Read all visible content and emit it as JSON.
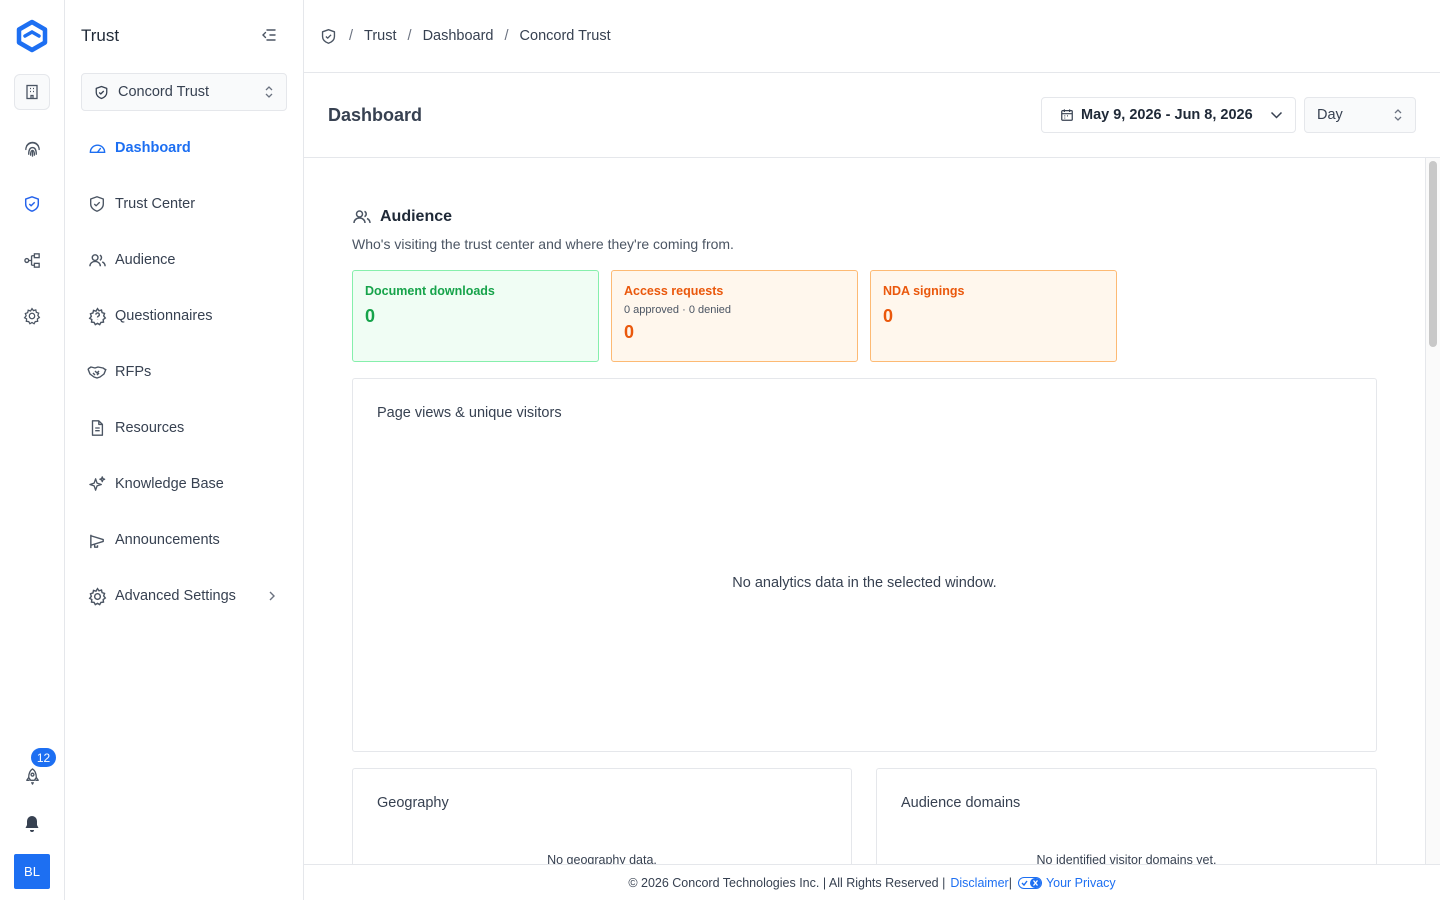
{
  "rail": {
    "items": [
      {
        "name": "building-icon"
      },
      {
        "name": "fingerprint-icon"
      },
      {
        "name": "shield-check-icon"
      },
      {
        "name": "workflow-icon"
      },
      {
        "name": "gear-icon"
      }
    ],
    "notification_count": "12",
    "avatar_initials": "BL"
  },
  "sidebar": {
    "title": "Trust",
    "org_select": "Concord Trust",
    "items": [
      {
        "label": "Dashboard",
        "icon": "gauge-icon",
        "active": true
      },
      {
        "label": "Trust Center",
        "icon": "shield-check-icon"
      },
      {
        "label": "Audience",
        "icon": "users-icon"
      },
      {
        "label": "Questionnaires",
        "icon": "question-icon"
      },
      {
        "label": "RFPs",
        "icon": "handshake-icon"
      },
      {
        "label": "Resources",
        "icon": "document-icon"
      },
      {
        "label": "Knowledge Base",
        "icon": "sparkles-icon"
      },
      {
        "label": "Announcements",
        "icon": "megaphone-icon"
      },
      {
        "label": "Advanced Settings",
        "icon": "gear-icon"
      }
    ]
  },
  "breadcrumb": [
    "Trust",
    "Dashboard",
    "Concord Trust"
  ],
  "header": {
    "title": "Dashboard",
    "date_range": "May 9, 2026 - Jun 8, 2026",
    "interval": "Day"
  },
  "audience": {
    "title": "Audience",
    "subtitle": "Who's visiting the trust center and where they're coming from.",
    "stats": {
      "downloads": {
        "label": "Document downloads",
        "value": "0"
      },
      "access": {
        "label": "Access requests",
        "sub": "0 approved · 0 denied",
        "value": "0"
      },
      "nda": {
        "label": "NDA signings",
        "value": "0"
      }
    }
  },
  "page_views": {
    "title": "Page views & unique visitors",
    "empty": "No analytics data in the selected window."
  },
  "geography": {
    "title": "Geography",
    "empty": "No geography data."
  },
  "domains": {
    "title": "Audience domains",
    "empty": "No identified visitor domains yet."
  },
  "footer": {
    "copyright": "© 2026 Concord Technologies Inc. | All Rights Reserved |",
    "disclaimer": "Disclaimer",
    "privacy": "Your Privacy"
  },
  "colors": {
    "accent": "#1d6ff2",
    "success": "#16a34a",
    "warning": "#ea580c"
  }
}
